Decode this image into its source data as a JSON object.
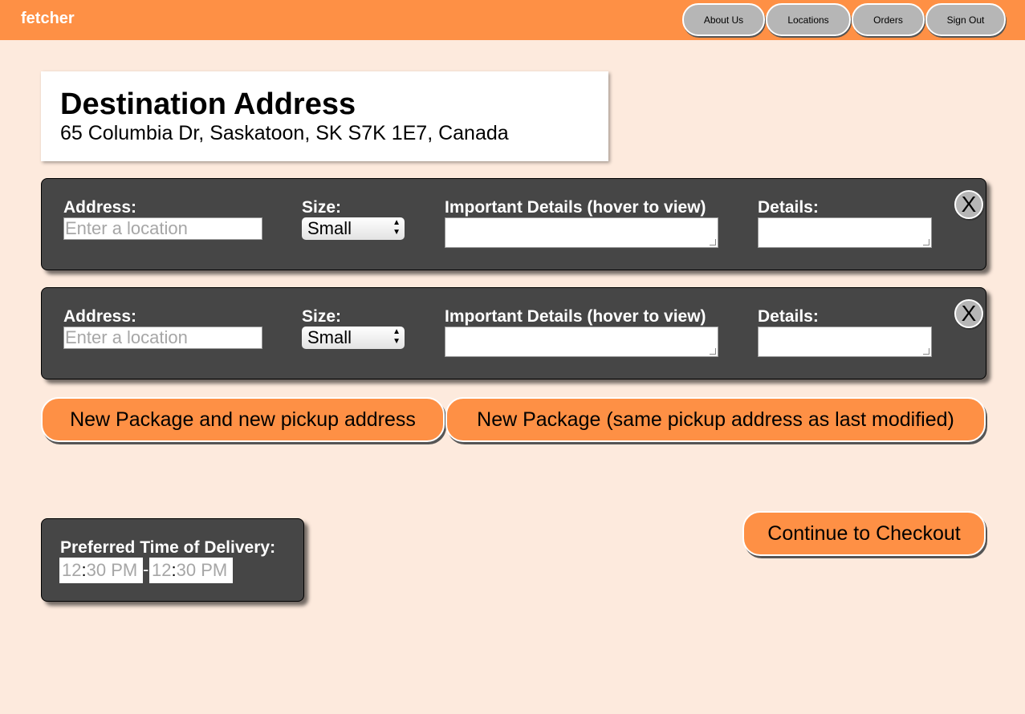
{
  "header": {
    "brand": "fetcher",
    "nav": [
      "About Us",
      "Locations",
      "Orders",
      "Sign Out"
    ]
  },
  "destination": {
    "title": "Destination Address",
    "address": "65 Columbia Dr, Saskatoon, SK S7K 1E7, Canada"
  },
  "packages": [
    {
      "address_label": "Address:",
      "address_placeholder": "Enter a location",
      "size_label": "Size:",
      "size_value": "Small",
      "important_label": "Important Details (hover to view)",
      "details_label": "Details:",
      "close_label": "X"
    },
    {
      "address_label": "Address:",
      "address_placeholder": "Enter a location",
      "size_label": "Size:",
      "size_value": "Small",
      "important_label": "Important Details (hover to view)",
      "details_label": "Details:",
      "close_label": "X"
    }
  ],
  "buttons": {
    "new_package_new_pickup": "New Package and new pickup address",
    "new_package_same_pickup": "New Package (same pickup address as last modified)",
    "checkout": "Continue to Checkout"
  },
  "delivery_time": {
    "label": "Preferred Time of Delivery:",
    "start": {
      "hour": "12",
      "separator": ":",
      "rest": "30 PM"
    },
    "range_separator": "-",
    "end": {
      "hour": "12",
      "separator": ":",
      "rest": "30 PM"
    }
  },
  "colors": {
    "accent": "#fe9045",
    "background": "#fdeadd",
    "panel": "#464646",
    "nav_button": "#b6b6b6"
  }
}
